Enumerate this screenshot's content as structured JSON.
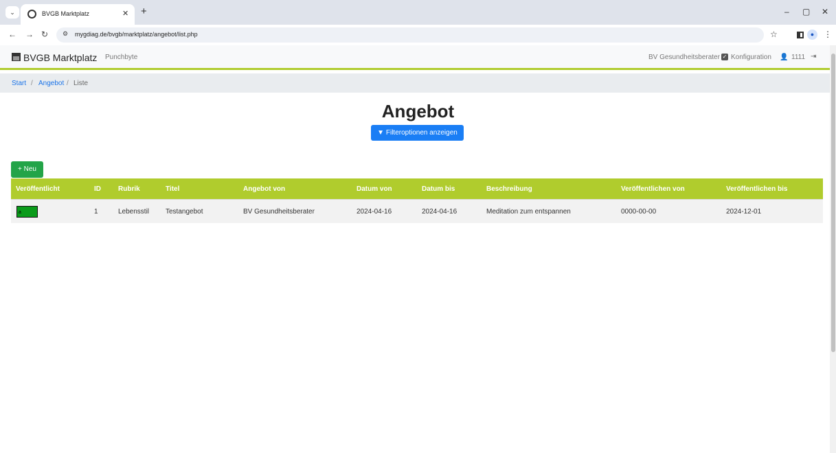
{
  "browser": {
    "tab_title": "BVGB Marktplatz",
    "url": "mygdiag.de/bvgb/marktplatz/angebot/list.php",
    "icons": [
      "tab-menu-icon",
      "globe-icon",
      "close-icon",
      "plus-icon",
      "minimize-icon",
      "restore-icon",
      "close-window-icon",
      "back-icon",
      "forward-icon",
      "reload-icon",
      "site-info-icon",
      "star-icon",
      "side-panel-icon",
      "profile-icon",
      "more-icon"
    ]
  },
  "navbar": {
    "brand": "BVGB Marktplatz",
    "secondary": "Punchbyte",
    "user_org": "BV Gesundheitsberater",
    "config": "Konfiguration",
    "user_id": "1111",
    "accent_color": "#b0cc2d"
  },
  "breadcrumb": {
    "start": "Start",
    "angebot": "Angebot",
    "current": "Liste",
    "separator": "/"
  },
  "main": {
    "title": "Angebot",
    "filter_button": "Filteroptionen anzeigen",
    "new_button": "Neu"
  },
  "table": {
    "headers": [
      "Veröffentlicht",
      "ID",
      "Rubrik",
      "Titel",
      "Angebot von",
      "Datum von",
      "Datum bis",
      "Beschreibung",
      "Veröffentlichen von",
      "Veröffentlichen bis"
    ],
    "rows": [
      {
        "status": "a",
        "status_color": "#0a9b1a",
        "id": "1",
        "rubrik": "Lebensstil",
        "titel": "Testangebot",
        "angebot_von": "BV Gesundheitsberater",
        "datum_von": "2024-04-16",
        "datum_bis": "2024-04-16",
        "beschreibung": "Meditation zum entspannen",
        "veroeffentlichen_von": "0000-00-00",
        "veroeffentlichen_bis": "2024-12-01"
      }
    ]
  }
}
